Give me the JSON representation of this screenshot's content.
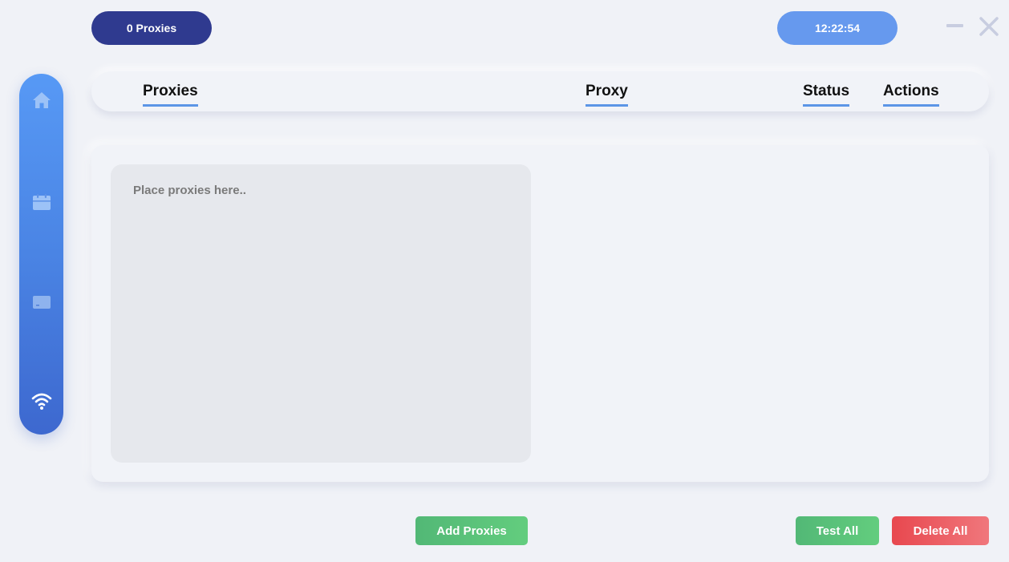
{
  "topbar": {
    "proxy_count": "0 Proxies",
    "clock": "12:22:54"
  },
  "window_controls": {
    "minimize_icon": "minus-icon",
    "close_icon": "close-icon"
  },
  "sidebar": {
    "items": [
      {
        "id": "home",
        "icon": "home-icon",
        "active": false
      },
      {
        "id": "calendar",
        "icon": "calendar-icon",
        "active": false
      },
      {
        "id": "terminal",
        "icon": "terminal-icon",
        "active": false
      },
      {
        "id": "proxies",
        "icon": "wifi-icon",
        "active": true
      }
    ]
  },
  "header": {
    "columns": [
      "Proxies",
      "Proxy",
      "Status",
      "Actions"
    ]
  },
  "editor": {
    "value": "",
    "placeholder": "Place proxies here.."
  },
  "actions": {
    "add_label": "Add Proxies",
    "test_label": "Test All",
    "delete_label": "Delete All"
  },
  "colors": {
    "background": "#f0f2f7",
    "count_pill": "#2f3a8f",
    "clock_pill": "#6699ee",
    "accent_underline": "#5b95e6",
    "green_button": "#5cc279",
    "red_button": "#ec5a60",
    "sidebar_top": "#5799f5",
    "sidebar_bottom": "#3d68cf"
  }
}
